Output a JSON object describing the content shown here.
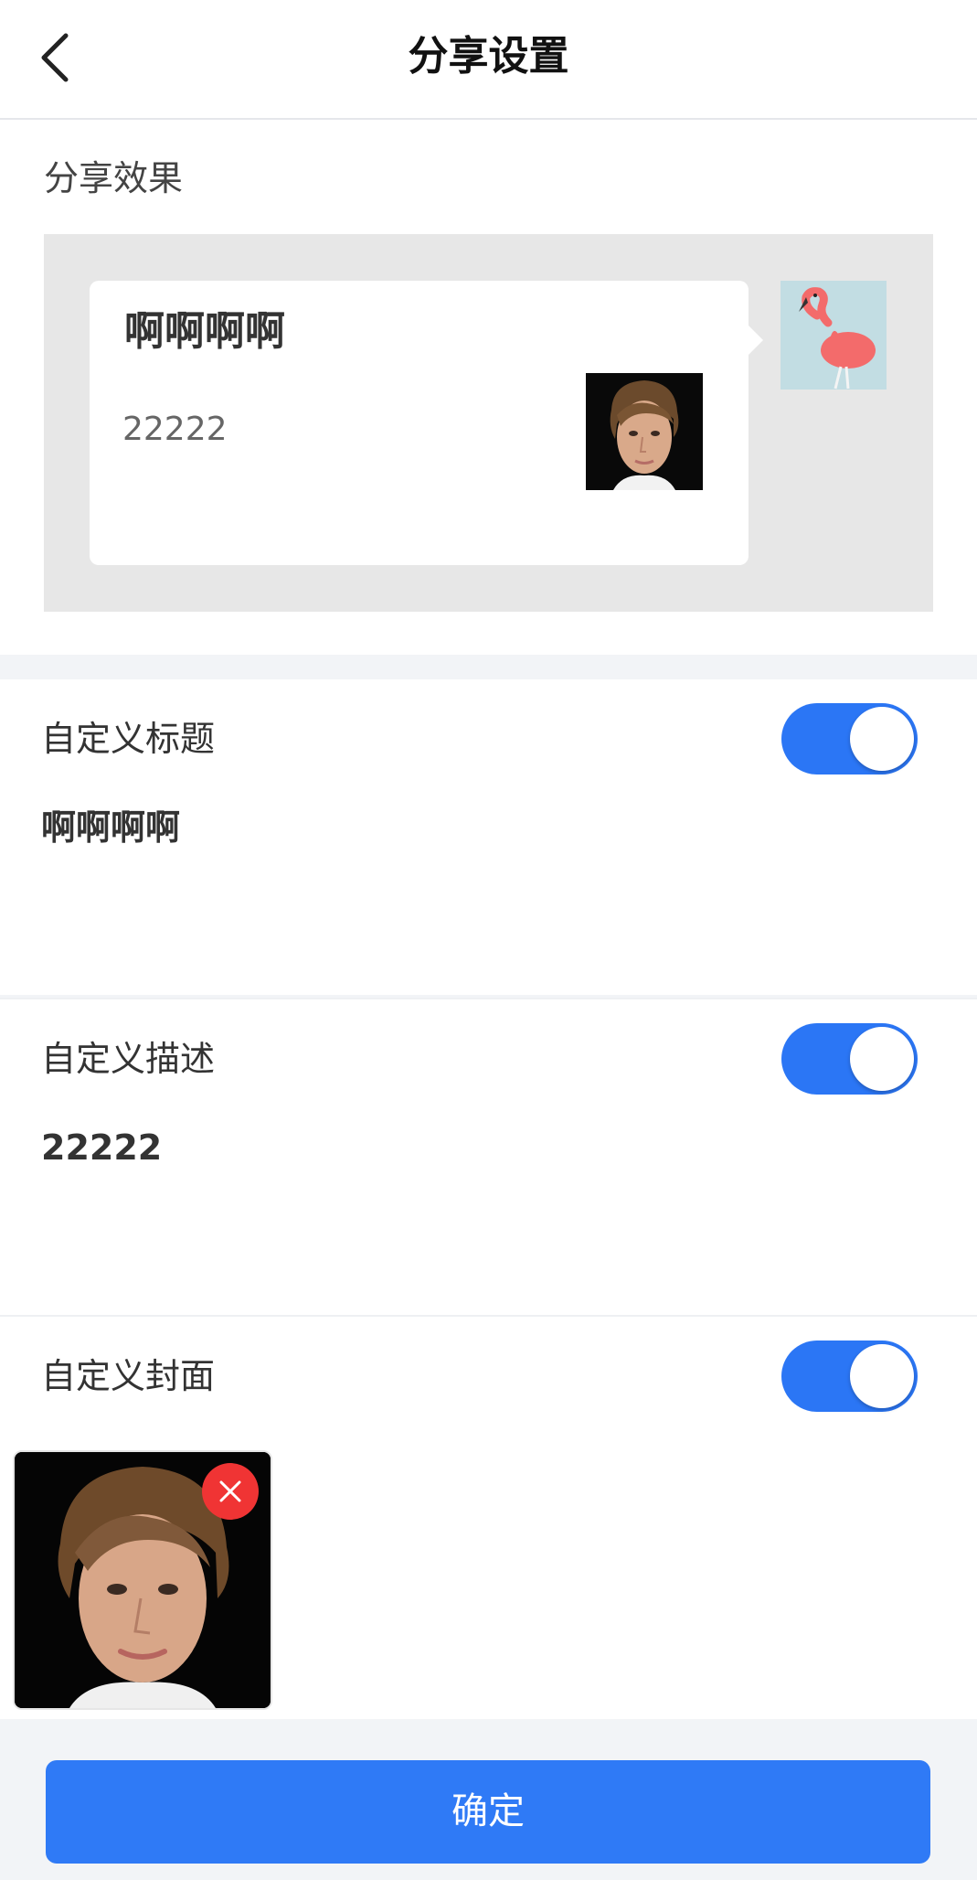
{
  "header": {
    "title": "分享设置",
    "back_icon": "chevron-left-icon"
  },
  "preview": {
    "label": "分享效果",
    "card": {
      "title": "啊啊啊啊",
      "description": "22222",
      "thumbnail": "portrait-photo"
    },
    "avatar": "flamingo-avatar"
  },
  "settings": [
    {
      "label": "自定义标题",
      "enabled": true,
      "value": "啊啊啊啊"
    },
    {
      "label": "自定义描述",
      "enabled": true,
      "value": "22222"
    },
    {
      "label": "自定义封面",
      "enabled": true,
      "cover_image": "portrait-photo",
      "remove_icon": "close-icon"
    }
  ],
  "confirm_label": "确定",
  "colors": {
    "accent": "#2b76f5",
    "danger": "#f03434",
    "page_bg": "#f2f4f7",
    "preview_bg": "#e7e7e7"
  }
}
